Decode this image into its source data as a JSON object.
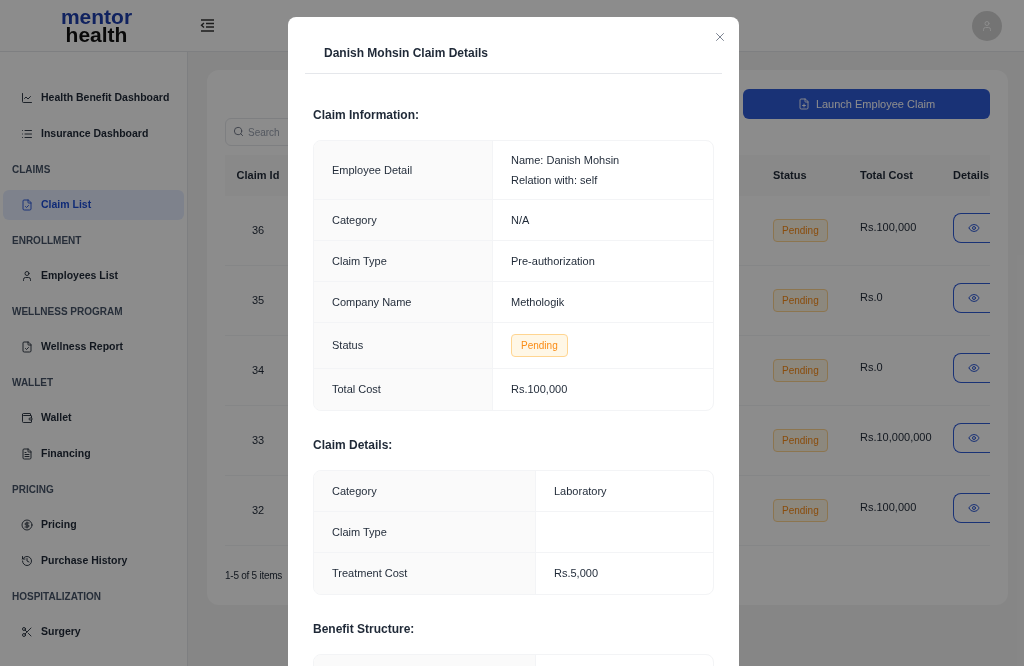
{
  "header": {
    "logo": [
      "mentor",
      "health"
    ]
  },
  "sidebar": {
    "items": [
      {
        "kind": "item",
        "label": "Health Benefit Dashboard",
        "selected": false
      },
      {
        "kind": "item",
        "label": "Insurance Dashboard",
        "selected": false
      },
      {
        "kind": "heading",
        "label": "CLAIMS"
      },
      {
        "kind": "item",
        "label": "Claim List",
        "selected": true
      },
      {
        "kind": "heading",
        "label": "ENROLLMENT"
      },
      {
        "kind": "item",
        "label": "Employees List",
        "selected": false
      },
      {
        "kind": "heading",
        "label": "WELLNESS PROGRAM"
      },
      {
        "kind": "item",
        "label": "Wellness Report",
        "selected": false
      },
      {
        "kind": "heading",
        "label": "WALLET"
      },
      {
        "kind": "item",
        "label": "Wallet",
        "selected": false
      },
      {
        "kind": "item",
        "label": "Financing",
        "selected": false
      },
      {
        "kind": "heading",
        "label": "PRICING"
      },
      {
        "kind": "item",
        "label": "Pricing",
        "selected": false
      },
      {
        "kind": "item",
        "label": "Purchase History",
        "selected": false
      },
      {
        "kind": "heading",
        "label": "HOSPITALIZATION"
      },
      {
        "kind": "item",
        "label": "Surgery",
        "selected": false
      }
    ]
  },
  "claims": {
    "launch_button": "Launch Employee Claim",
    "search": {
      "placeholder": "Search"
    },
    "columns": [
      "Claim Id",
      "Status",
      "Total Cost",
      "Details"
    ],
    "rows": [
      {
        "claim_id": "36",
        "status": "Pending",
        "total_cost": "Rs.100,000"
      },
      {
        "claim_id": "35",
        "status": "Pending",
        "total_cost": "Rs.0"
      },
      {
        "claim_id": "34",
        "status": "Pending",
        "total_cost": "Rs.0"
      },
      {
        "claim_id": "33",
        "status": "Pending",
        "total_cost": "Rs.10,000,000"
      },
      {
        "claim_id": "32",
        "status": "Pending",
        "total_cost": "Rs.100,000"
      }
    ],
    "pagination": "1-5 of 5 items"
  },
  "modal": {
    "title": "Danish Mohsin Claim Details",
    "sections": [
      {
        "title": "Claim Information:",
        "rows": [
          {
            "label": "Employee Detail",
            "values": [
              "Name: Danish Mohsin",
              "Relation with: self"
            ]
          },
          {
            "label": "Category",
            "values": [
              "N/A"
            ]
          },
          {
            "label": "Claim Type",
            "values": [
              "Pre-authorization"
            ]
          },
          {
            "label": "Company Name",
            "values": [
              "Methologik"
            ]
          },
          {
            "label": "Status",
            "kind": "tag",
            "values": [
              "Pending"
            ]
          },
          {
            "label": "Total Cost",
            "values": [
              "Rs.100,000"
            ]
          }
        ]
      },
      {
        "title": "Claim Details:",
        "rows": [
          {
            "label": "Category",
            "values": [
              "Laboratory"
            ]
          },
          {
            "label": "Claim Type",
            "values": []
          },
          {
            "label": "Treatment Cost",
            "values": [
              "Rs.5,000"
            ]
          }
        ]
      },
      {
        "title": "Benefit Structure:"
      }
    ]
  }
}
